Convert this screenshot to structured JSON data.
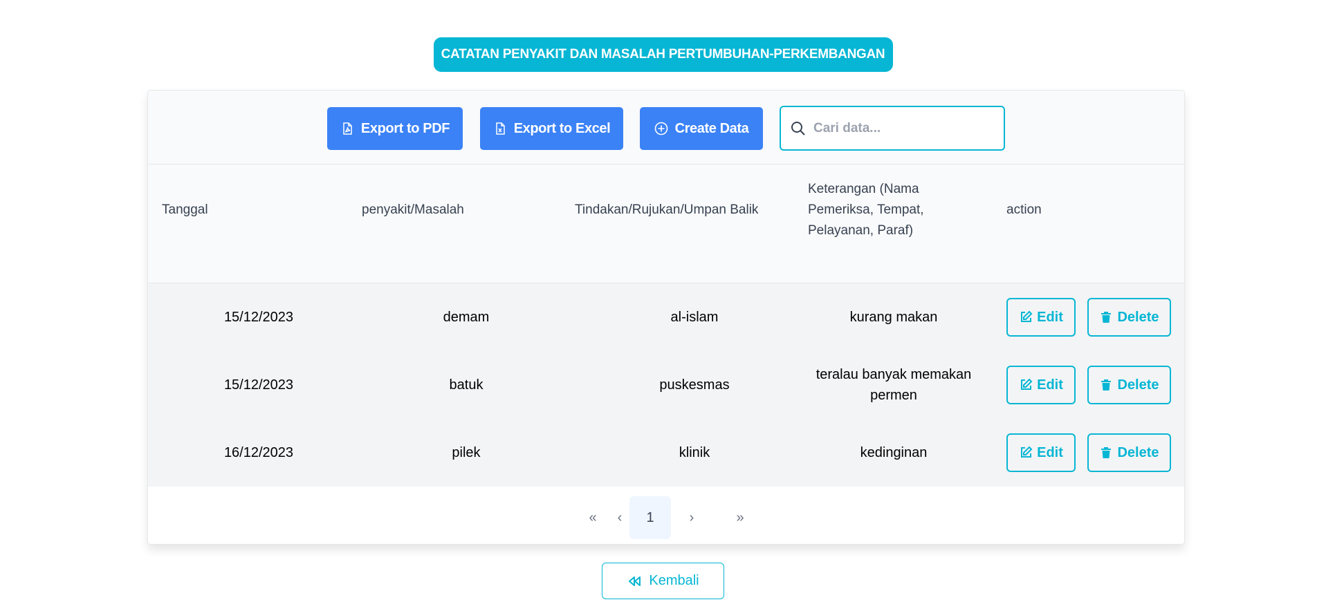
{
  "page": {
    "title": "CATATAN PENYAKIT DAN MASALAH PERTUMBUHAN-PERKEMBANGAN"
  },
  "toolbar": {
    "export_pdf_label": "Export to PDF",
    "export_excel_label": "Export to Excel",
    "create_label": "Create Data",
    "search_placeholder": "Cari data..."
  },
  "table": {
    "headers": {
      "tanggal": "Tanggal",
      "penyakit": "penyakit/Masalah",
      "tindakan": "Tindakan/Rujukan/Umpan Balik",
      "keterangan": "Keterangan (Nama Pemeriksa, Tempat, Pelayanan, Paraf)",
      "action": "action"
    },
    "rows": [
      {
        "tanggal": "15/12/2023",
        "penyakit": "demam",
        "tindakan": "al-islam",
        "keterangan": "kurang makan",
        "edit": "Edit",
        "delete": "Delete"
      },
      {
        "tanggal": "15/12/2023",
        "penyakit": "batuk",
        "tindakan": "puskesmas",
        "keterangan": "teralau banyak memakan permen",
        "edit": "Edit",
        "delete": "Delete"
      },
      {
        "tanggal": "16/12/2023",
        "penyakit": "pilek",
        "tindakan": "klinik",
        "keterangan": "kedinginan",
        "edit": "Edit",
        "delete": "Delete"
      }
    ]
  },
  "pagination": {
    "first": "«",
    "prev": "‹",
    "current": "1",
    "next": "›",
    "last": "»"
  },
  "footer": {
    "back_label": "Kembali"
  },
  "colors": {
    "accent": "#06b6d4",
    "primary": "#3b82f6"
  },
  "icons": {
    "export_pdf": "file-pdf-icon",
    "export_excel": "file-excel-icon",
    "create": "plus-circle-icon",
    "search": "search-icon",
    "edit": "edit-icon",
    "delete": "trash-icon",
    "back": "double-chevron-left-icon"
  }
}
